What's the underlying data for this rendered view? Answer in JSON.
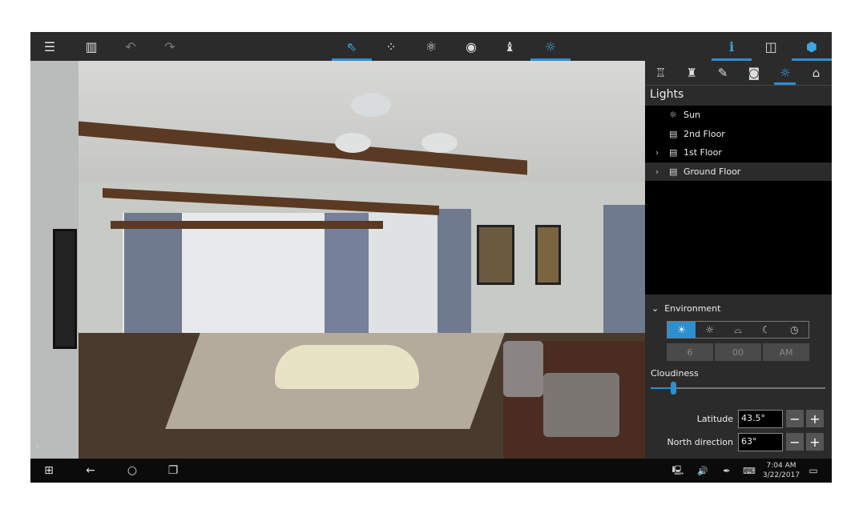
{
  "toolbar": {
    "left": [
      {
        "icon": "menu-icon",
        "g": "☰"
      },
      {
        "icon": "library-icon",
        "g": "▥"
      },
      {
        "icon": "undo-icon",
        "g": "↶"
      },
      {
        "icon": "redo-icon",
        "g": "↷"
      }
    ],
    "center": [
      {
        "icon": "select-icon",
        "g": "⇖",
        "active": true
      },
      {
        "icon": "footprints-icon",
        "g": "⁘"
      },
      {
        "icon": "atom-icon",
        "g": "⚛"
      },
      {
        "icon": "eye-icon",
        "g": "◉"
      },
      {
        "icon": "chess-icon",
        "g": "♝"
      },
      {
        "icon": "sun-icon",
        "g": "☼",
        "active": true
      }
    ],
    "right": [
      {
        "icon": "info-icon",
        "g": "ℹ",
        "active": true
      },
      {
        "icon": "floorplan-icon",
        "g": "◫"
      },
      {
        "icon": "cube-icon",
        "g": "⬢",
        "active": true
      }
    ]
  },
  "panel": {
    "tabs": [
      {
        "icon": "furniture-icon",
        "g": "♖"
      },
      {
        "icon": "paint-brush-icon",
        "g": "♜"
      },
      {
        "icon": "pencil-icon",
        "g": "✎"
      },
      {
        "icon": "camera-icon",
        "g": "◙"
      },
      {
        "icon": "sun-icon",
        "g": "☼",
        "active": true
      },
      {
        "icon": "house-icon",
        "g": "⌂"
      }
    ],
    "title": "Lights",
    "items": [
      {
        "label": "Sun",
        "icon": "sun-icon",
        "g": "☼",
        "expandable": false
      },
      {
        "label": "2nd Floor",
        "icon": "floor-icon",
        "g": "▤",
        "expandable": false
      },
      {
        "label": "1st Floor",
        "icon": "floor-icon",
        "g": "▤",
        "expandable": true
      },
      {
        "label": "Ground Floor",
        "icon": "floor-icon",
        "g": "▤",
        "expandable": true,
        "selected": true
      }
    ],
    "environment": {
      "title": "Environment",
      "modes": [
        {
          "icon": "sunrise-icon",
          "g": "☀",
          "active": true
        },
        {
          "icon": "sun-icon",
          "g": "☼"
        },
        {
          "icon": "sunset-icon",
          "g": "⌓"
        },
        {
          "icon": "moon-icon",
          "g": "☾"
        },
        {
          "icon": "clock-icon",
          "g": "◷"
        }
      ],
      "time": {
        "hour": "6",
        "minute": "00",
        "ampm": "AM"
      },
      "cloudiness_label": "Cloudiness",
      "cloudiness": 0.13,
      "latitude_label": "Latitude",
      "latitude": "43.5°",
      "north_label": "North direction",
      "north": "63°",
      "minus": "−",
      "plus": "+"
    }
  },
  "taskbar": {
    "time": "7:04 AM",
    "date": "3/22/2017"
  },
  "colors": {
    "accent": "#2d8fd0",
    "toolbar": "#2b2b2b"
  }
}
